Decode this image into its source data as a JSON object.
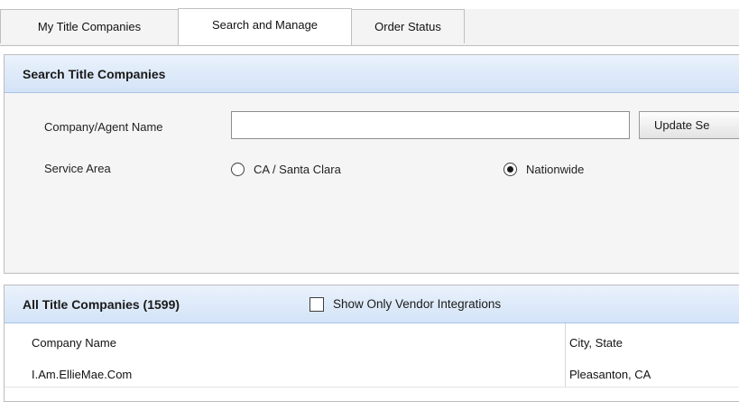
{
  "tabs": [
    {
      "label": "My Title Companies"
    },
    {
      "label": "Search and Manage"
    },
    {
      "label": "Order Status"
    }
  ],
  "search_panel": {
    "title": "Search Title Companies",
    "company_label": "Company/Agent Name",
    "company_value": "",
    "update_button": "Update Se",
    "service_area_label": "Service Area",
    "options": [
      {
        "label": "CA / Santa Clara",
        "selected": false
      },
      {
        "label": "Nationwide",
        "selected": true
      }
    ]
  },
  "results_panel": {
    "title": "All Title Companies (1599)",
    "vendor_checkbox_label": "Show Only Vendor Integrations",
    "vendor_checkbox_checked": false,
    "columns": [
      "Company Name",
      "City, State"
    ],
    "rows": [
      {
        "company": "I.Am.EllieMae.Com",
        "city_state": "Pleasanton, CA"
      }
    ]
  }
}
